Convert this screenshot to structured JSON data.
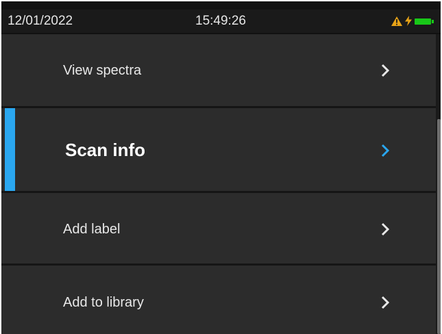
{
  "status": {
    "date": "12/01/2022",
    "time": "15:49:26",
    "icons": [
      "warning-icon",
      "charging-bolt-icon",
      "battery-icon"
    ],
    "colors": {
      "warning": "#e8a317",
      "bolt": "#e8a317",
      "battery": "#18c818"
    }
  },
  "menu": {
    "items": [
      {
        "label": "View spectra",
        "selected": false
      },
      {
        "label": "Scan info",
        "selected": true
      },
      {
        "label": "Add label",
        "selected": false
      },
      {
        "label": "Add to library",
        "selected": false
      }
    ]
  },
  "colors": {
    "accent": "#2aa7f0",
    "item_background": "#2c2c2c",
    "chevron_default": "#e8e8e8",
    "chevron_selected": "#2aa7f0"
  }
}
